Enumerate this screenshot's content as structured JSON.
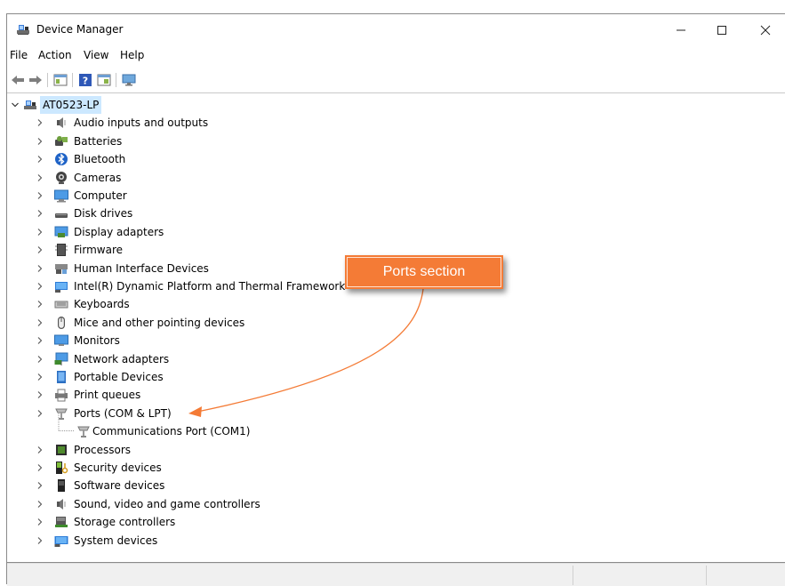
{
  "window": {
    "title": "Device Manager",
    "controls": {
      "minimize": "–",
      "maximize": "☐",
      "close": "✕"
    }
  },
  "menu": [
    "File",
    "Action",
    "View",
    "Help"
  ],
  "toolbar": {
    "buttons": [
      "back-icon",
      "forward-icon",
      "properties-icon",
      "help-icon",
      "details-icon",
      "monitor-icon"
    ]
  },
  "tree": {
    "root": "AT0523-LP",
    "items": [
      {
        "label": "Audio inputs and outputs",
        "icon": "speaker-icon"
      },
      {
        "label": "Batteries",
        "icon": "battery-icon"
      },
      {
        "label": "Bluetooth",
        "icon": "bluetooth-icon"
      },
      {
        "label": "Cameras",
        "icon": "camera-icon"
      },
      {
        "label": "Computer",
        "icon": "computer-icon"
      },
      {
        "label": "Disk drives",
        "icon": "disk-icon"
      },
      {
        "label": "Display adapters",
        "icon": "display-adapter-icon"
      },
      {
        "label": "Firmware",
        "icon": "firmware-icon"
      },
      {
        "label": "Human Interface Devices",
        "icon": "hid-icon"
      },
      {
        "label": "Intel(R) Dynamic Platform and Thermal Framework",
        "icon": "intel-icon"
      },
      {
        "label": "Keyboards",
        "icon": "keyboard-icon"
      },
      {
        "label": "Mice and other pointing devices",
        "icon": "mouse-icon"
      },
      {
        "label": "Monitors",
        "icon": "monitor-icon"
      },
      {
        "label": "Network adapters",
        "icon": "network-icon"
      },
      {
        "label": "Portable Devices",
        "icon": "portable-device-icon"
      },
      {
        "label": "Print queues",
        "icon": "printer-icon"
      },
      {
        "label": "Ports (COM & LPT)",
        "icon": "port-icon"
      },
      {
        "label": "Communications Port (COM1)",
        "icon": "port-icon"
      },
      {
        "label": "Processors",
        "icon": "processor-icon"
      },
      {
        "label": "Security devices",
        "icon": "security-icon"
      },
      {
        "label": "Software devices",
        "icon": "software-device-icon"
      },
      {
        "label": "Sound, video and game controllers",
        "icon": "speaker-icon"
      },
      {
        "label": "Storage controllers",
        "icon": "storage-icon"
      },
      {
        "label": "System devices",
        "icon": "system-icon"
      }
    ]
  },
  "callout": {
    "text": "Ports section",
    "color": "#f47b36"
  }
}
